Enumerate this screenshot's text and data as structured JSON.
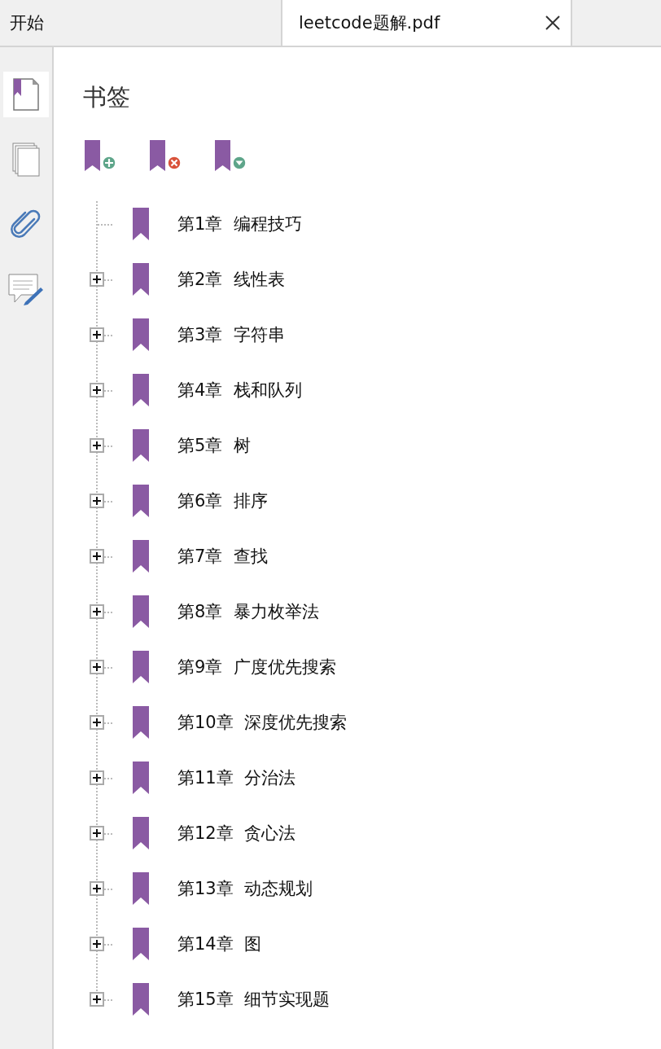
{
  "tabs": [
    {
      "label": "开始",
      "selected": false
    },
    {
      "label": "leetcode题解.pdf",
      "selected": true
    }
  ],
  "sidebar": {
    "items": [
      {
        "kind": "bookmarks",
        "selected": true
      },
      {
        "kind": "pages",
        "selected": false
      },
      {
        "kind": "attachments",
        "selected": false
      },
      {
        "kind": "comments",
        "selected": false
      }
    ]
  },
  "panel": {
    "title": "书签",
    "toolbar": [
      {
        "kind": "add"
      },
      {
        "kind": "delete"
      },
      {
        "kind": "expand"
      }
    ]
  },
  "bookmarks": [
    {
      "chapter": "第1章",
      "title": "编程技巧",
      "expandable": false
    },
    {
      "chapter": "第2章",
      "title": "线性表",
      "expandable": true
    },
    {
      "chapter": "第3章",
      "title": "字符串",
      "expandable": true
    },
    {
      "chapter": "第4章",
      "title": "栈和队列",
      "expandable": true
    },
    {
      "chapter": "第5章",
      "title": "树",
      "expandable": true
    },
    {
      "chapter": "第6章",
      "title": "排序",
      "expandable": true
    },
    {
      "chapter": "第7章",
      "title": "查找",
      "expandable": true
    },
    {
      "chapter": "第8章",
      "title": "暴力枚举法",
      "expandable": true
    },
    {
      "chapter": "第9章",
      "title": "广度优先搜索",
      "expandable": true
    },
    {
      "chapter": "第10章",
      "title": "深度优先搜索",
      "expandable": true
    },
    {
      "chapter": "第11章",
      "title": "分治法",
      "expandable": true
    },
    {
      "chapter": "第12章",
      "title": "贪心法",
      "expandable": true
    },
    {
      "chapter": "第13章",
      "title": "动态规划",
      "expandable": true
    },
    {
      "chapter": "第14章",
      "title": "图",
      "expandable": true
    },
    {
      "chapter": "第15章",
      "title": "细节实现题",
      "expandable": true
    }
  ]
}
